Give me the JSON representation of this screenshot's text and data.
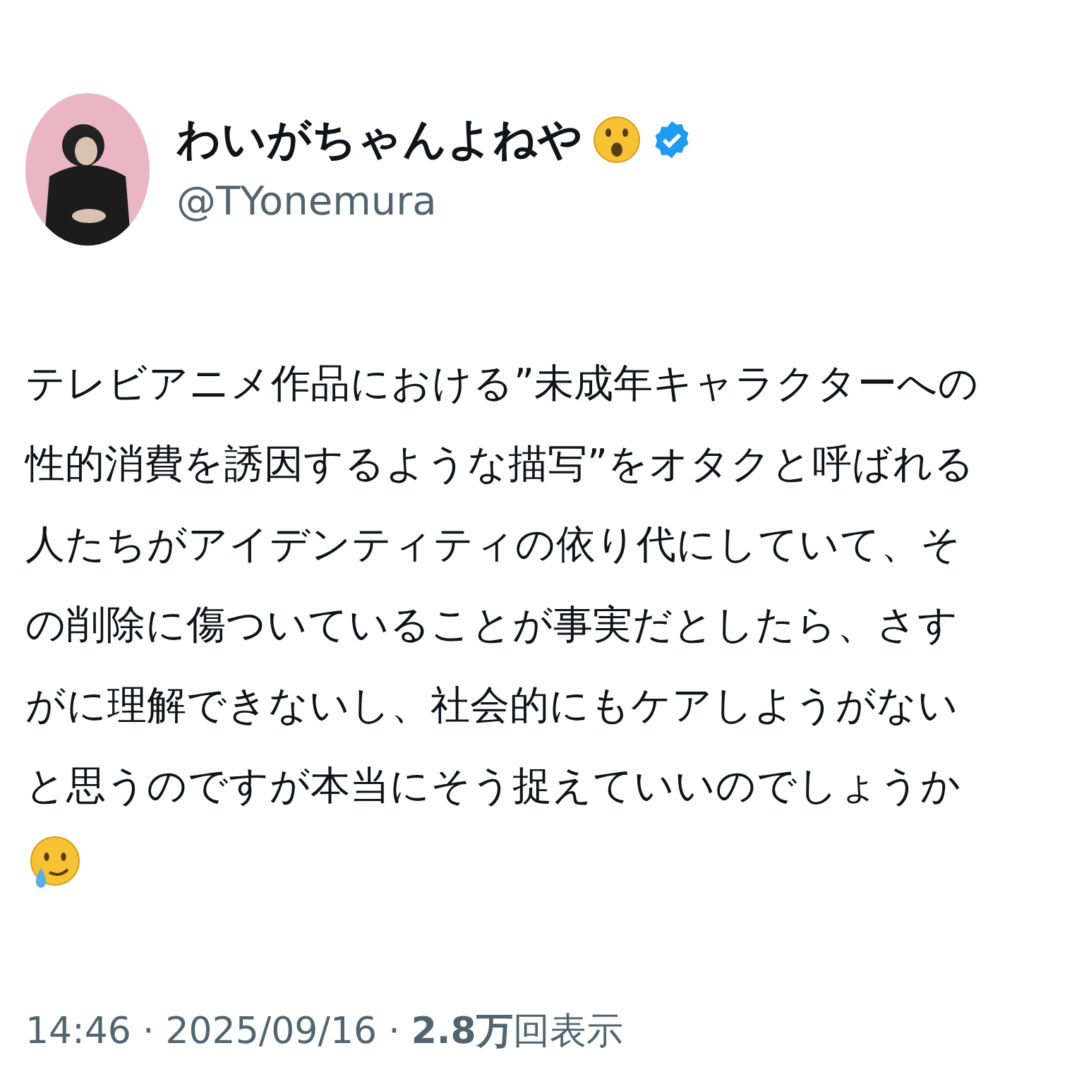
{
  "author": {
    "name": "わいがちゃんよねや",
    "verified": true,
    "handle": "@TYonemura"
  },
  "body": {
    "lines": [
      "テレビアニメ作品における”未成年キャラクターへの",
      "性的消費を誘因するような描写”をオタクと呼ばれる",
      "人たちがアイデンティティの依り代にしていて、そ",
      "の削除に傷ついていることが事実だとしたら、さす",
      "がに理解できないし、社会的にもケアしようがない",
      "と思うのですが本当にそう捉えていいのでしょうか"
    ]
  },
  "meta": {
    "time": "14:46",
    "separator_1": "·",
    "date": "2025/09/16",
    "separator_2": "·",
    "views": "**2.8万**回表示"
  }
}
